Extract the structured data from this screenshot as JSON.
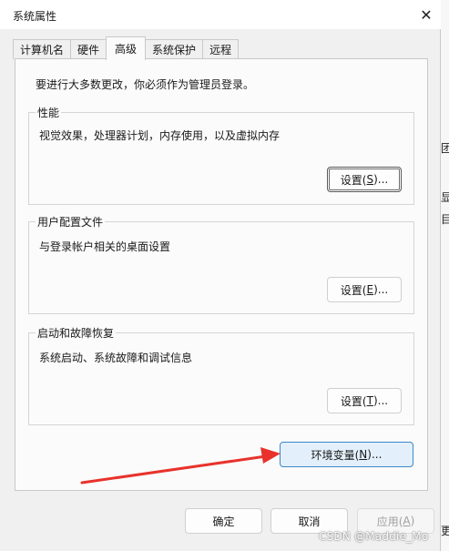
{
  "window": {
    "title": "系统属性"
  },
  "tabs": [
    {
      "label": "计算机名",
      "active": false
    },
    {
      "label": "硬件",
      "active": false
    },
    {
      "label": "高级",
      "active": true
    },
    {
      "label": "系统保护",
      "active": false
    },
    {
      "label": "远程",
      "active": false
    }
  ],
  "advanced": {
    "notice": "要进行大多数更改，你必须作为管理员登录。",
    "performance": {
      "legend": "性能",
      "description": "视觉效果，处理器计划，内存使用，以及虚拟内存",
      "button": {
        "label": "设置(",
        "accel": "S",
        "suffix": ")..."
      }
    },
    "profiles": {
      "legend": "用户配置文件",
      "description": "与登录帐户相关的桌面设置",
      "button": {
        "label": "设置(",
        "accel": "E",
        "suffix": ")..."
      }
    },
    "startup": {
      "legend": "启动和故障恢复",
      "description": "系统启动、系统故障和调试信息",
      "button": {
        "label": "设置(",
        "accel": "T",
        "suffix": ")..."
      }
    },
    "env_button": {
      "label": "环境变量(",
      "accel": "N",
      "suffix": ")..."
    }
  },
  "footer": {
    "ok": "确定",
    "cancel": "取消",
    "apply": {
      "label": "应用(",
      "accel": "A",
      "suffix": ")"
    }
  },
  "background_window_fragments": [
    "团",
    "显",
    "目",
    "更"
  ],
  "watermark": "CSDN @Maddie_Mo",
  "colors": {
    "annotation_arrow": "#e8322b",
    "primary_button_border": "#3c87c8",
    "primary_button_fill": "#e3f0fb"
  }
}
